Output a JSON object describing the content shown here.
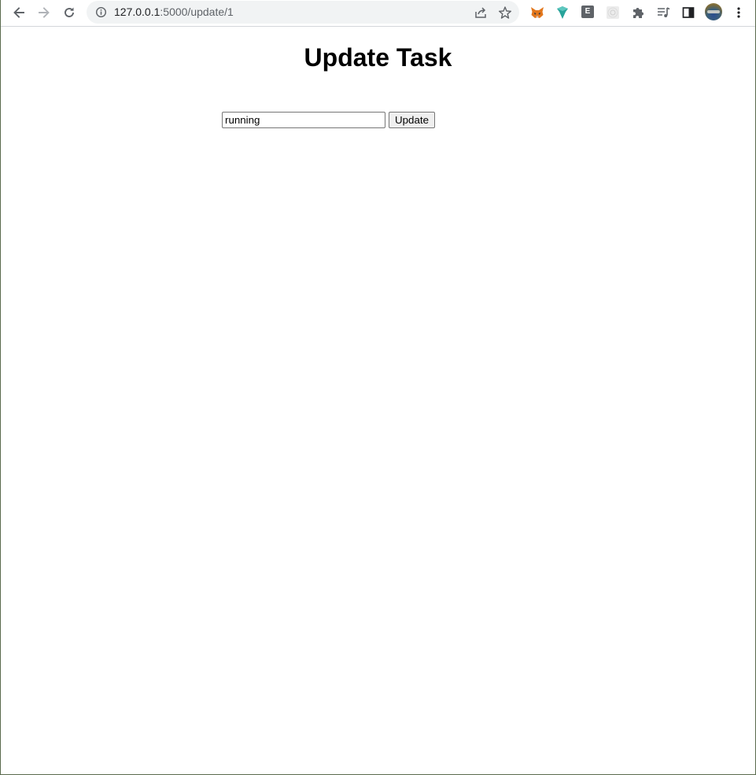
{
  "browser": {
    "url_host": "127.0.0.1",
    "url_rest": ":5000/update/1",
    "icons": {
      "back": "arrow-left-icon",
      "forward": "arrow-right-icon",
      "reload": "reload-icon",
      "site_info": "info-icon",
      "share": "share-icon",
      "bookmark": "star-icon",
      "extensions": [
        "fox-extension-icon",
        "shield-extension-icon",
        "e-extension-icon",
        "grid-extension-icon",
        "puzzle-icon",
        "media-queue-icon",
        "side-panel-icon",
        "avatar",
        "kebab-menu-icon"
      ]
    },
    "extension_e_label": "E"
  },
  "page": {
    "title": "Update Task",
    "input_value": "running",
    "button_label": "Update"
  }
}
